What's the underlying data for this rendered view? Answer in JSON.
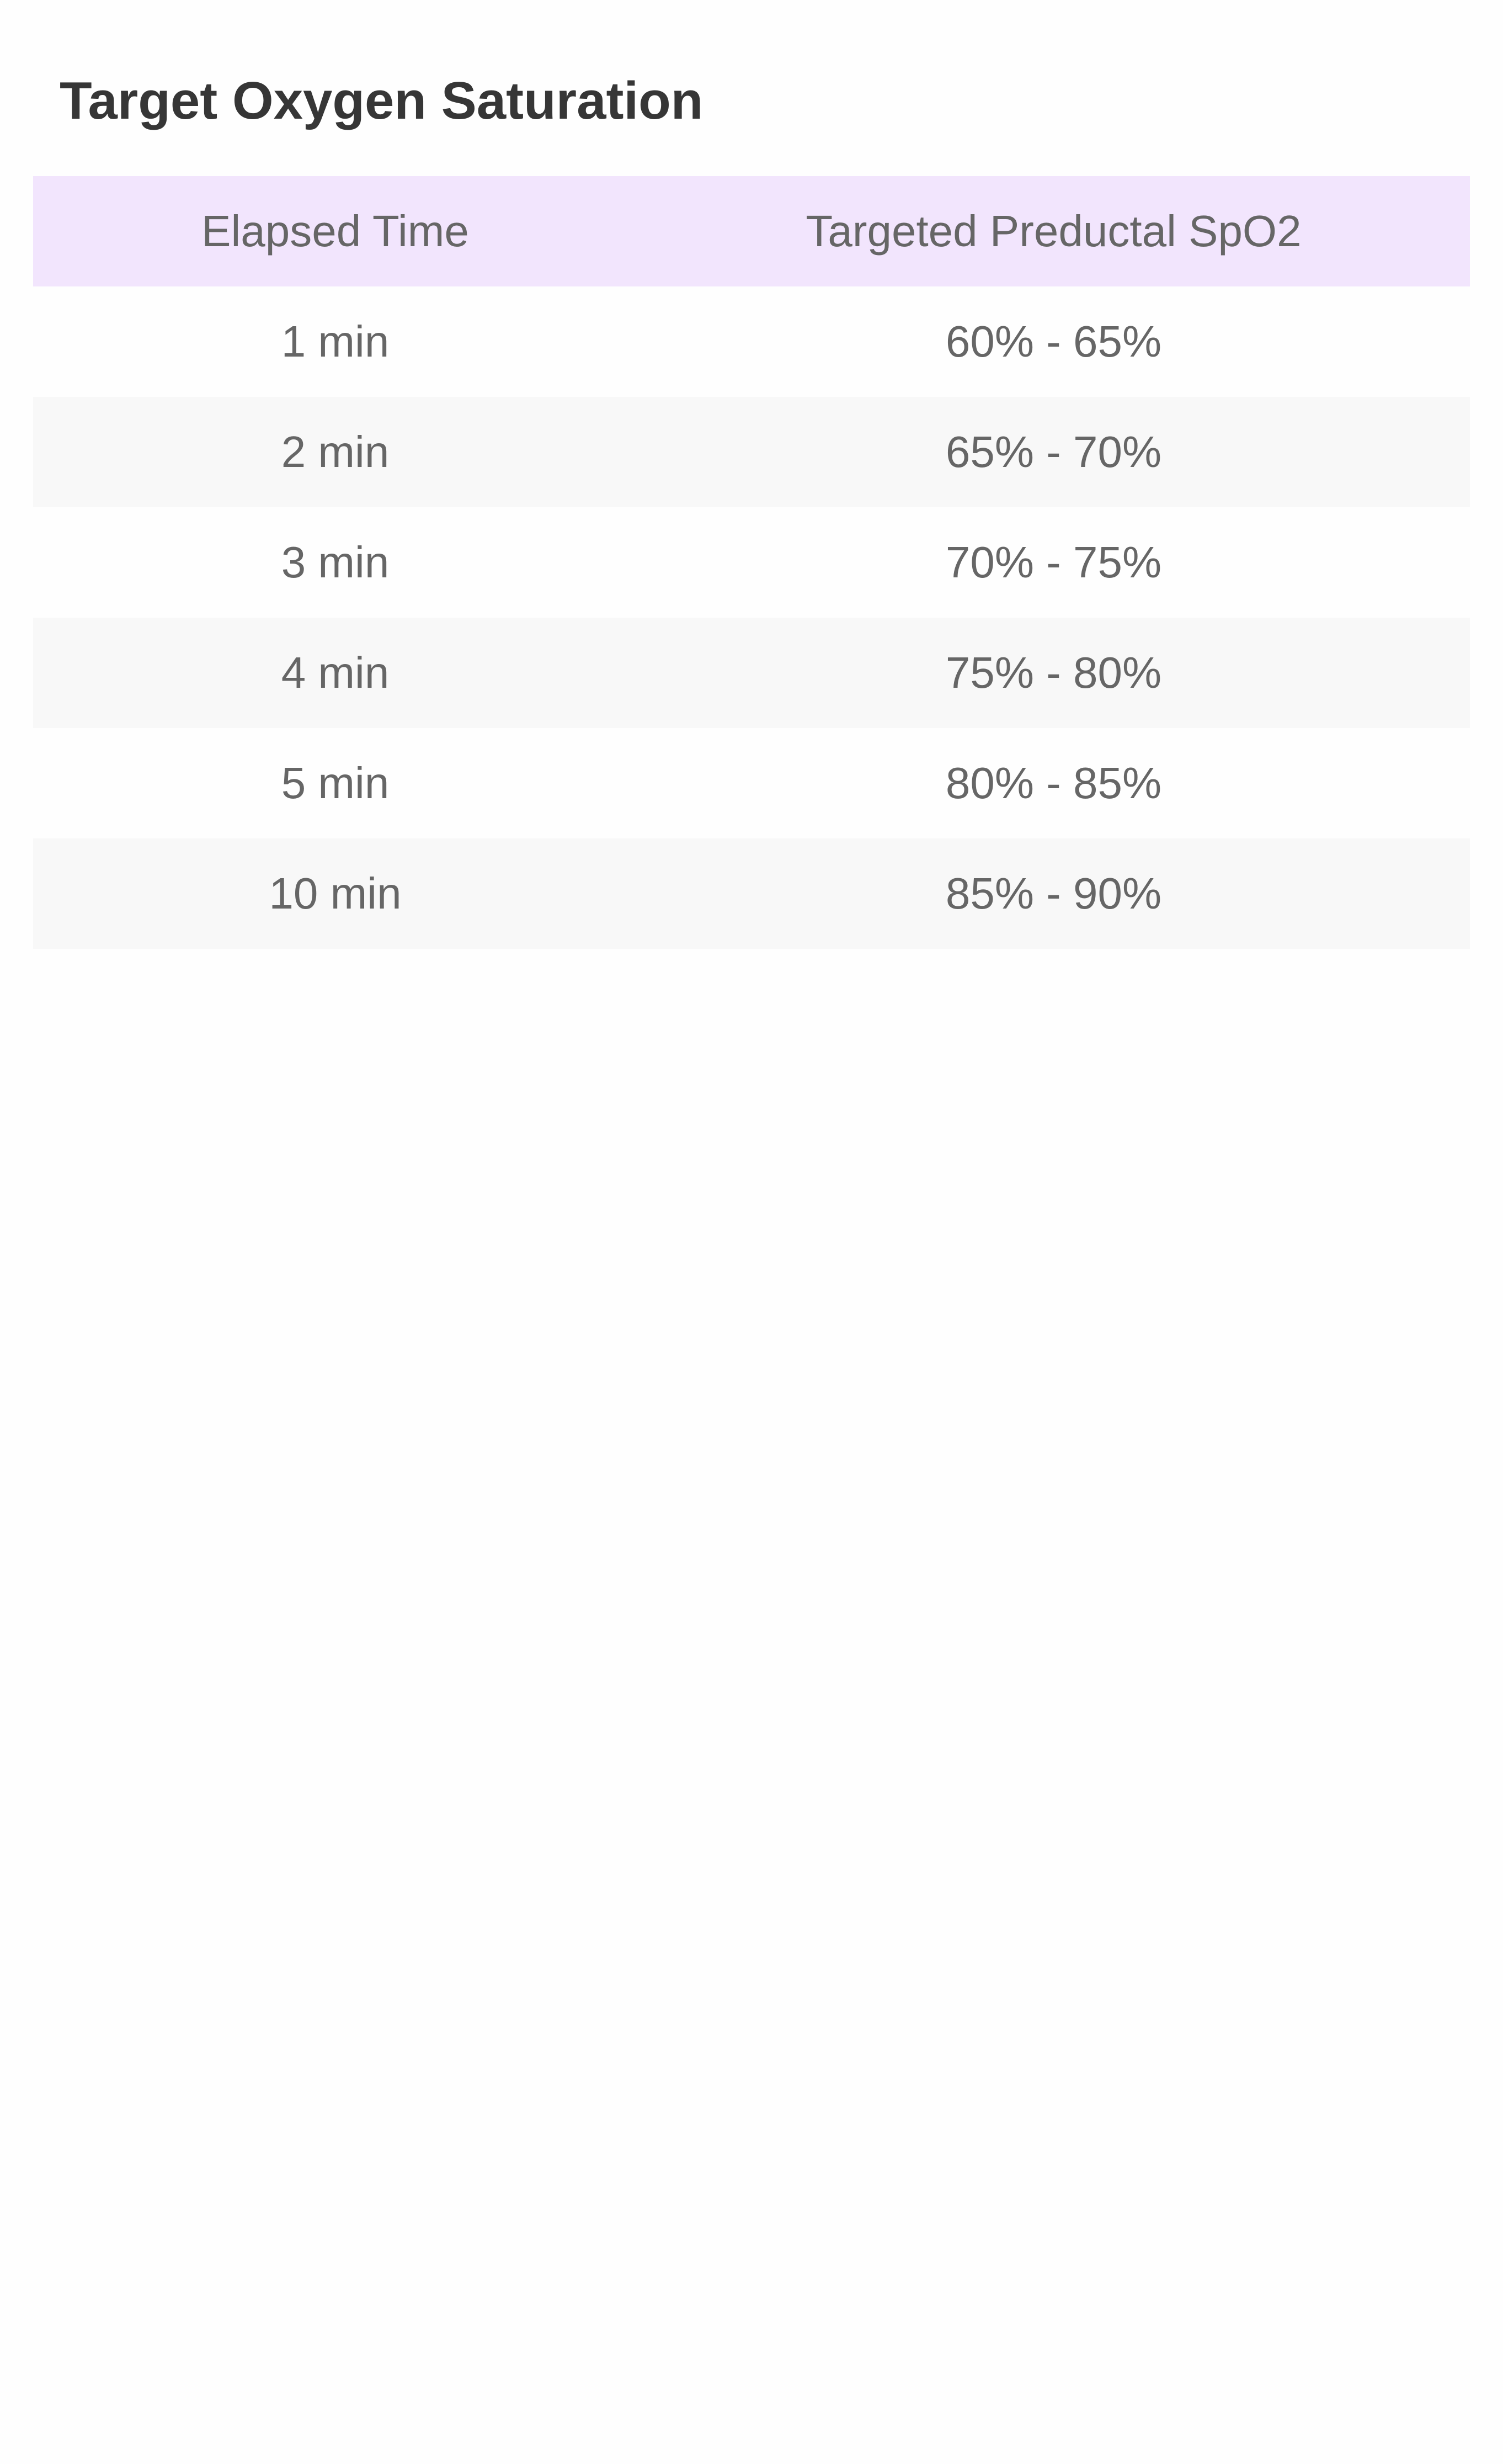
{
  "title": "Target Oxygen Saturation",
  "table": {
    "columns": [
      "Elapsed Time",
      "Targeted Preductal SpO2"
    ],
    "rows": [
      [
        "1 min",
        "60% - 65%"
      ],
      [
        "2 min",
        "65% - 70%"
      ],
      [
        "3 min",
        "70% - 75%"
      ],
      [
        "4 min",
        "75% - 80%"
      ],
      [
        "5 min",
        "80% - 85%"
      ],
      [
        "10 min",
        "85% - 90%"
      ]
    ]
  },
  "colors": {
    "header_background": "#f2e5fd",
    "alt_row_background": "#f8f8f8",
    "title_text": "#363636",
    "cell_text": "#666666"
  }
}
